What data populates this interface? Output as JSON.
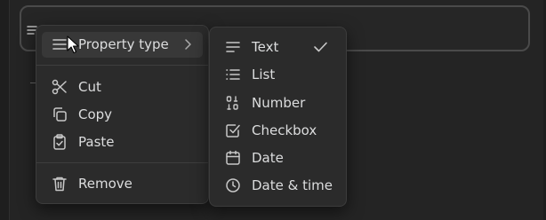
{
  "main_menu": {
    "property_type": "Property type",
    "cut": "Cut",
    "copy": "Copy",
    "paste": "Paste",
    "remove": "Remove"
  },
  "type_menu": {
    "selected": "Text",
    "items": [
      "Text",
      "List",
      "Number",
      "Checkbox",
      "Date",
      "Date & time"
    ]
  },
  "icons": {
    "property_type": "align-left-icon",
    "cut": "scissors-icon",
    "copy": "copy-icon",
    "paste": "clipboard-check-icon",
    "remove": "trash-icon",
    "text": "text-lines-icon",
    "list": "list-icon",
    "number": "binary-icon",
    "checkbox": "checkbox-icon",
    "date": "calendar-icon",
    "date_time": "clock-icon"
  },
  "colors": {
    "background": "#1e1e1e",
    "menu": "#2b2b2b",
    "highlight": "#383838",
    "text": "#dcddde"
  }
}
